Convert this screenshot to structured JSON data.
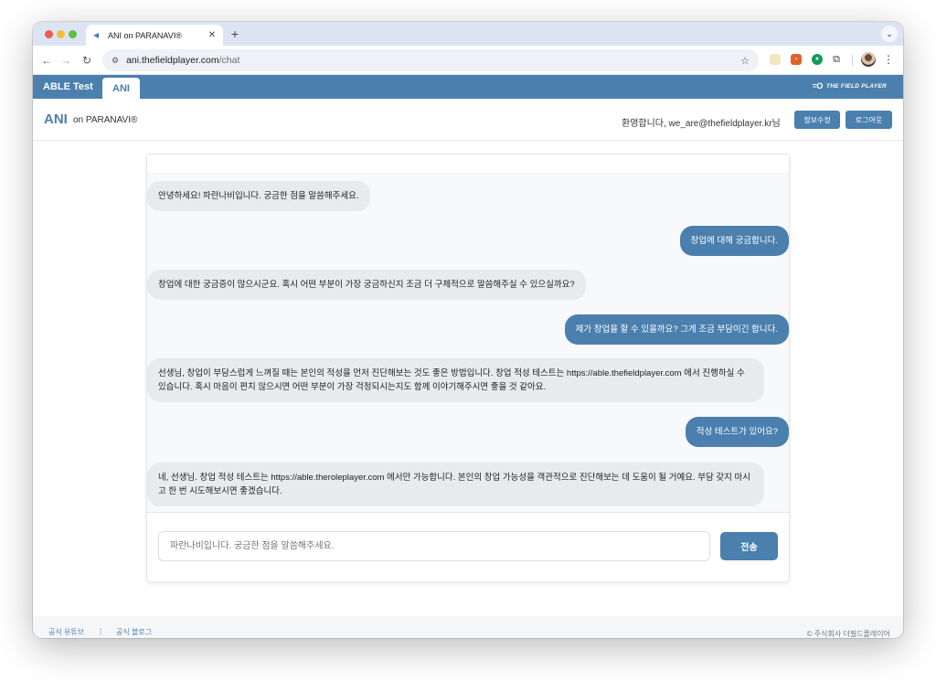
{
  "browser": {
    "tab_title": "ANI on PARANAVI®",
    "new_tab_symbol": "+",
    "url_host": "ani.thefieldplayer.com",
    "url_path": "/chat",
    "icons": [
      "back-icon",
      "forward-icon",
      "reload-icon",
      "site-info-icon",
      "bookmark-star-icon",
      "extensions-icon",
      "menu-icon"
    ]
  },
  "appbar": {
    "tabs": [
      {
        "label": "ABLE Test",
        "active": false
      },
      {
        "label": "ANI",
        "active": true
      }
    ],
    "brand_mark": "=O",
    "brand_text": "THE FIELD PLAYER"
  },
  "header": {
    "logo": "ANI",
    "logo_sub": "on PARANAVI®",
    "welcome": "환영합니다, we_are@thefieldplayer.kr님",
    "edit_profile_label": "정보수정",
    "logout_label": "로그아웃"
  },
  "chat": {
    "messages": [
      {
        "role": "bot",
        "text": "안녕하세요! 파란나비입니다. 궁금한 점을 말씀해주세요."
      },
      {
        "role": "user",
        "text": "창업에 대해 궁금합니다."
      },
      {
        "role": "bot",
        "text": "창업에 대한 궁금증이 많으시군요. 혹시 어떤 부분이 가장 궁금하신지 조금 더 구체적으로 말씀해주실 수 있으실까요?"
      },
      {
        "role": "user",
        "text": "제가 창업을 할 수 있을까요? 그게 조금 부담이긴 합니다."
      },
      {
        "role": "bot",
        "text": "선생님, 창업이 부담스럽게 느껴질 때는 본인의 적성을 먼저 진단해보는 것도 좋은 방법입니다. 창업 적성 테스트는 https://able.thefieldplayer.com 에서 진행하실 수 있습니다. 혹시 마음이 편치 않으시면 어떤 부분이 가장 걱정되시는지도 함께 이야기해주시면 좋을 것 같아요."
      },
      {
        "role": "user",
        "text": "적성 테스트가 있어요?"
      },
      {
        "role": "bot",
        "text": "네, 선생님. 창업 적성 테스트는 https://able.theroleplayer.com 에서만 가능합니다. 본인의 창업 가능성을 객관적으로 진단해보는 데 도움이 될 거예요. 부담 갖지 마시고 한 번 시도해보시면 좋겠습니다."
      }
    ],
    "input_placeholder": "파란나비입니다. 궁금한 점을 말씀해주세요.",
    "send_label": "전송"
  },
  "footer": {
    "link_youtube": "공식 유튜브",
    "separator": "|",
    "link_blog": "공식 블로그",
    "copyright": "© 주식회사 더필드플레이어"
  },
  "colors": {
    "accent": "#4a7fae",
    "bot_bubble": "#e9eaec",
    "chrome_tabstrip": "#dce4f4"
  }
}
